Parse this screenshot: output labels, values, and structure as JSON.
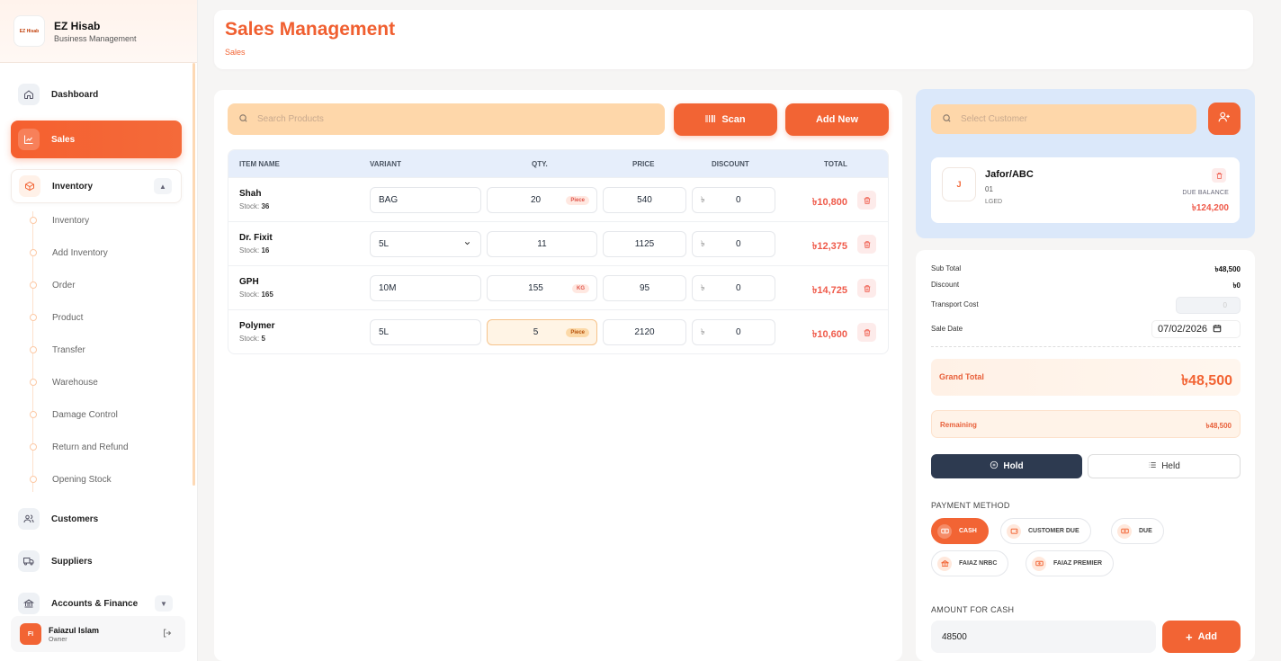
{
  "brand": {
    "logo_text": "EZ Hisab",
    "name": "EZ Hisab",
    "subtitle": "Business Management"
  },
  "sidebar": {
    "dashboard": "Dashboard",
    "sales": "Sales",
    "inventory": "Inventory",
    "inventory_items": [
      "Inventory",
      "Add Inventory",
      "Order",
      "Product",
      "Transfer",
      "Warehouse",
      "Damage Control",
      "Return and Refund",
      "Opening Stock"
    ],
    "customers": "Customers",
    "suppliers": "Suppliers",
    "accounts": "Accounts & Finance"
  },
  "user": {
    "initials": "FI",
    "name": "Faiazul Islam",
    "role": "Owner"
  },
  "header": {
    "title": "Sales Management",
    "breadcrumb": "Sales"
  },
  "toolbar": {
    "search_placeholder": "Search Products",
    "scan_label": "Scan",
    "add_new_label": "Add New"
  },
  "table": {
    "headers": {
      "item": "ITEM NAME",
      "variant": "VARIANT",
      "qty": "QTY.",
      "price": "PRICE",
      "discount": "DISCOUNT",
      "total": "TOTAL"
    },
    "rows": [
      {
        "name": "Shah",
        "stock_label": "Stock:",
        "stock": "36",
        "variant": "BAG",
        "qty": "20",
        "unit": "Piece",
        "price": "540",
        "currency": "৳",
        "discount": "0",
        "total": "৳10,800"
      },
      {
        "name": "Dr. Fixit",
        "stock_label": "Stock:",
        "stock": "16",
        "variant": "5L",
        "qty": "11",
        "unit": "",
        "price": "1125",
        "currency": "৳",
        "discount": "0",
        "total": "৳12,375"
      },
      {
        "name": "GPH",
        "stock_label": "Stock:",
        "stock": "165",
        "variant": "10M",
        "qty": "155",
        "unit": "KG",
        "price": "95",
        "currency": "৳",
        "discount": "0",
        "total": "৳14,725"
      },
      {
        "name": "Polymer",
        "stock_label": "Stock:",
        "stock": "5",
        "variant": "5L",
        "qty": "5",
        "unit": "Piece",
        "price": "2120",
        "currency": "৳",
        "discount": "0",
        "total": "৳10,600"
      }
    ]
  },
  "customer": {
    "search_placeholder": "Select Customer",
    "initial": "J",
    "name": "Jafor/ABC",
    "code": "01",
    "type": "LGED",
    "due_label": "DUE BALANCE",
    "due_value": "৳124,200"
  },
  "summary": {
    "subtotal_label": "Sub Total",
    "subtotal": "৳48,500",
    "discount_label": "Discount",
    "discount": "৳0",
    "transport_label": "Transport Cost",
    "transport": "0",
    "date_label": "Sale Date",
    "date": "07/02/2026",
    "grand_label": "Grand Total",
    "grand": "৳48,500",
    "remaining_label": "Remaining",
    "remaining": "৳48,500",
    "hold_label": "Hold",
    "held_label": "Held"
  },
  "payment": {
    "title": "PAYMENT METHOD",
    "methods": [
      "CASH",
      "CUSTOMER DUE",
      "DUE",
      "FAIAZ NRBC",
      "FAIAZ PREMIER"
    ],
    "selected": "CASH",
    "amount_title": "AMOUNT FOR CASH",
    "amount": "48500",
    "add_label": "Add"
  },
  "colors": {
    "accent": "#f26434",
    "navy": "#2d3a50",
    "search_bg": "#fed7aa",
    "customer_card": "#dbe8fa"
  }
}
